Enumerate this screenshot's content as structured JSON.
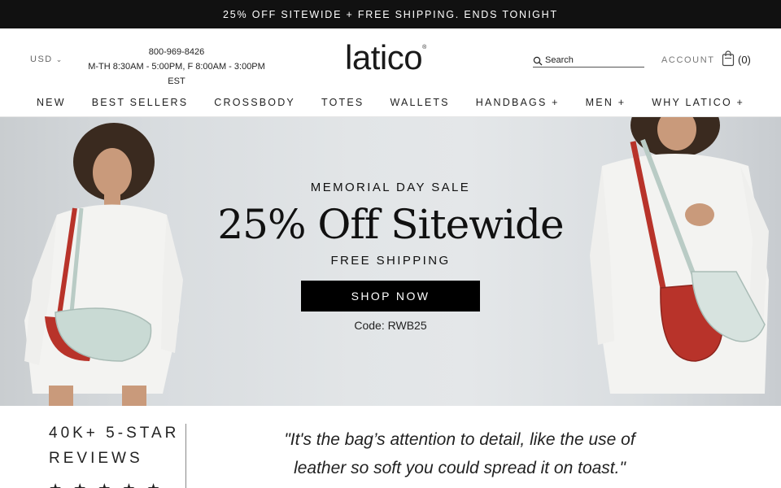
{
  "announcement": "25% OFF SITEWIDE + FREE SHIPPING. ENDS TONIGHT",
  "header": {
    "currency": "USD",
    "phone": "800-969-8426",
    "hours": "M-TH 8:30AM - 5:00PM, F 8:00AM - 3:00PM EST",
    "logo": "latico",
    "logo_mark": "®",
    "search_placeholder": "Search",
    "account": "ACCOUNT",
    "cart_count": "(0)"
  },
  "nav": {
    "items": [
      "NEW",
      "BEST SELLERS",
      "CROSSBODY",
      "TOTES",
      "WALLETS",
      "HANDBAGS +",
      "MEN +",
      "WHY LATICO +"
    ]
  },
  "hero": {
    "kicker": "MEMORIAL DAY SALE",
    "headline": "25% Off Sitewide",
    "subline": "FREE SHIPPING",
    "cta": "SHOP NOW",
    "code": "Code: RWB25"
  },
  "reviews": {
    "title": "40K+ 5-STAR REVIEWS",
    "stars": "★★★★★",
    "quote": "\"It's the bag’s attention to detail, like the use of leather so soft you could spread it on toast.\""
  },
  "colors": {
    "announcement_bg": "#111111",
    "cta_bg": "#000000",
    "bag_red": "#b8332a",
    "bag_mint": "#c9dad4"
  },
  "icons": {
    "currency": "chevron-down-icon",
    "search": "search-icon",
    "cart": "shopping-bag-icon"
  }
}
